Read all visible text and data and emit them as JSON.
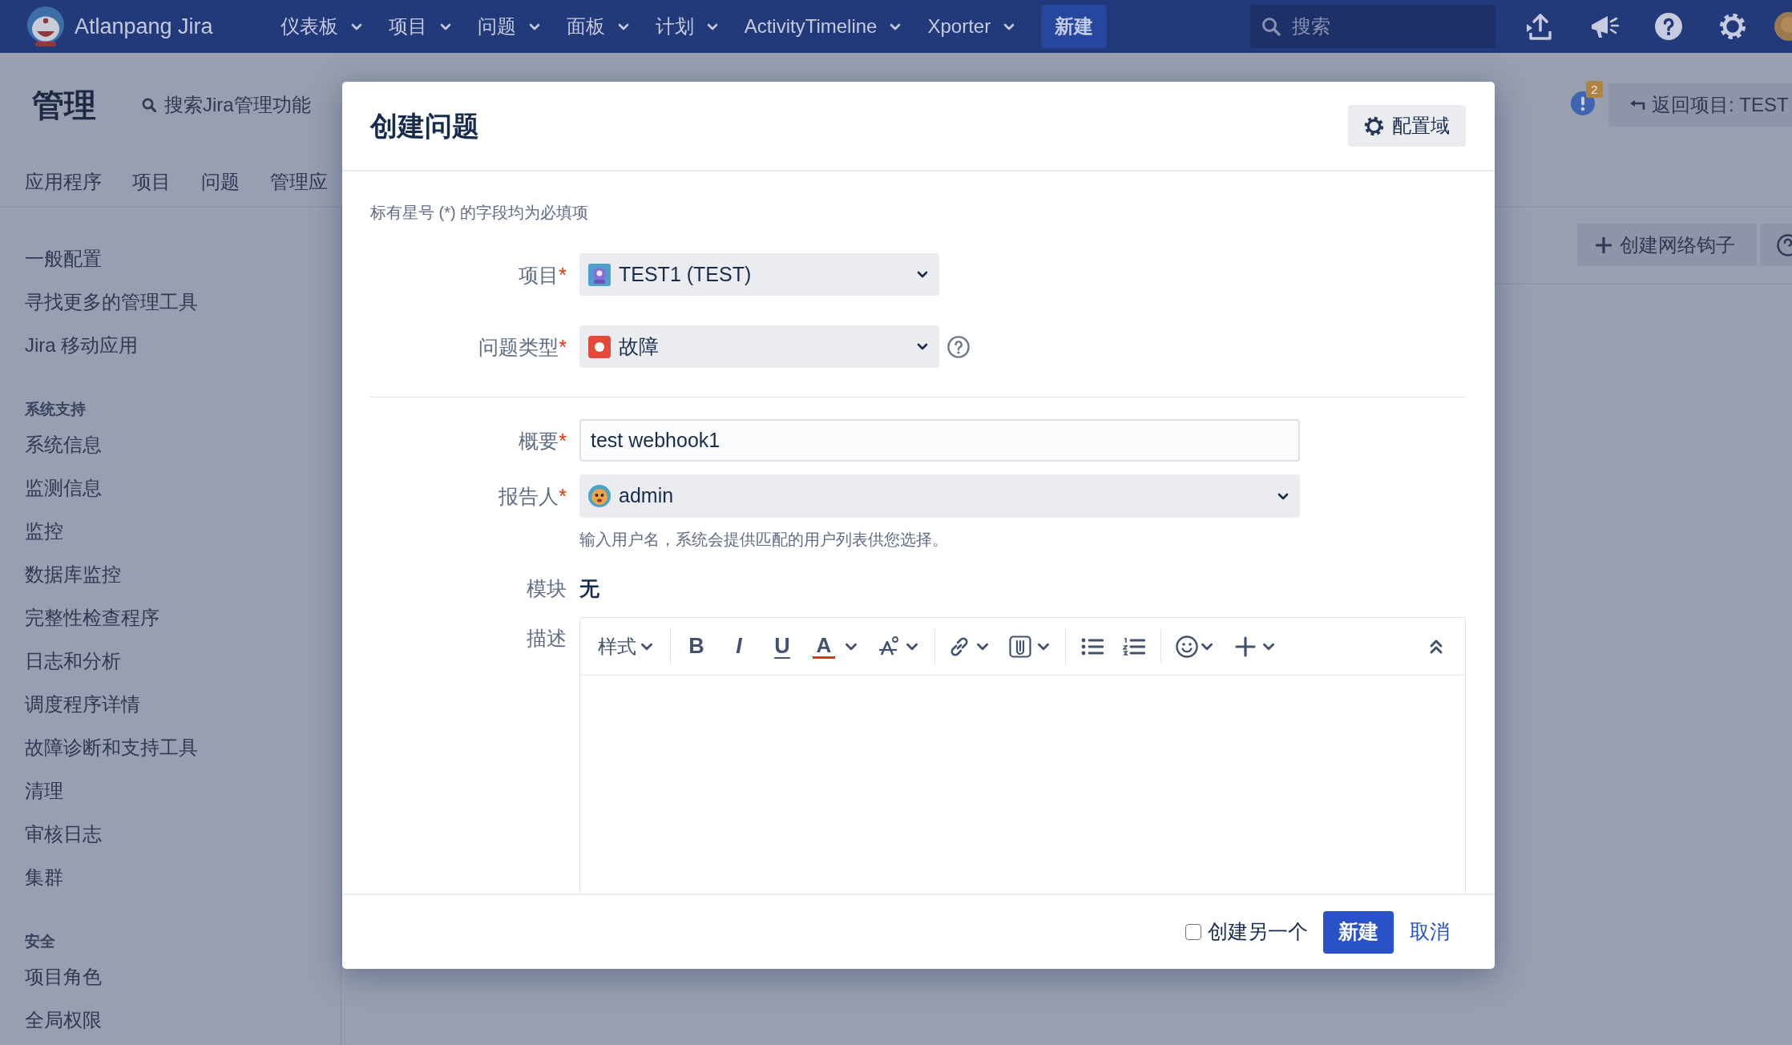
{
  "top_nav": {
    "logo_text": "Atlanpang Jira",
    "menus": [
      "仪表板",
      "项目",
      "问题",
      "面板",
      "计划",
      "ActivityTimeline",
      "Xporter"
    ],
    "create_button": "新建",
    "search": {
      "placeholder": "搜索"
    }
  },
  "admin_header": {
    "title": "管理",
    "search_link": "搜索Jira管理功能",
    "tabs": [
      {
        "label": "应用程序",
        "selected": false
      },
      {
        "label": "项目",
        "selected": false
      },
      {
        "label": "问题",
        "selected": false
      },
      {
        "label": "管理应",
        "selected": false
      }
    ],
    "notification_count": "2",
    "back_button": "返回项目: TEST"
  },
  "sidebar": {
    "sections": [
      {
        "items": [
          {
            "label": "一般配置",
            "selected": false
          },
          {
            "label": "寻找更多的管理工具",
            "selected": false
          },
          {
            "label": "Jira 移动应用",
            "selected": false
          }
        ]
      },
      {
        "heading": "系统支持",
        "items": [
          {
            "label": "系统信息",
            "selected": false
          },
          {
            "label": "监测信息",
            "selected": false
          },
          {
            "label": "监控",
            "selected": false
          },
          {
            "label": "数据库监控",
            "selected": false
          },
          {
            "label": "完整性检查程序",
            "selected": false
          },
          {
            "label": "日志和分析",
            "selected": false
          },
          {
            "label": "调度程序详情",
            "selected": false
          },
          {
            "label": "故障诊断和支持工具",
            "selected": false
          },
          {
            "label": "清理",
            "selected": false
          },
          {
            "label": "审核日志",
            "selected": false
          },
          {
            "label": "集群",
            "selected": false
          }
        ]
      },
      {
        "heading": "安全",
        "items": [
          {
            "label": "项目角色",
            "selected": false
          },
          {
            "label": "全局权限",
            "selected": false
          }
        ]
      }
    ]
  },
  "content_toolbar": {
    "create_button": "创建网络钩子"
  },
  "dialog": {
    "title": "创建问题",
    "configure_button": "配置域",
    "required_note": "标有星号 (*) 的字段均为必填项",
    "sections": [
      {
        "fields": [
          {
            "kind": "project-select",
            "label": "项目",
            "required_mark": "*",
            "value": "TEST1 (TEST)"
          },
          {
            "kind": "type-select",
            "label": "问题类型",
            "required_mark": "*",
            "value": "故障"
          }
        ]
      },
      {
        "fields": [
          {
            "kind": "text",
            "label": "概要",
            "required_mark": "*",
            "value": "test webhook1"
          },
          {
            "kind": "user-select",
            "label": "报告人",
            "required_mark": "*",
            "value": "admin",
            "hint": "输入用户名，系统会提供匹配的用户列表供您选择。"
          },
          {
            "kind": "static",
            "label": "模块",
            "value": "无"
          },
          {
            "kind": "editor",
            "label": "描述",
            "toolbar": {
              "style_menu": "样式",
              "bold": "B",
              "italic": "I",
              "underline": "U",
              "text_color": "A"
            }
          }
        ]
      }
    ],
    "footer": {
      "create_another": {
        "label": "创建另一个",
        "checked": false
      },
      "submit_button": "新建",
      "cancel_link": "取消"
    }
  }
}
